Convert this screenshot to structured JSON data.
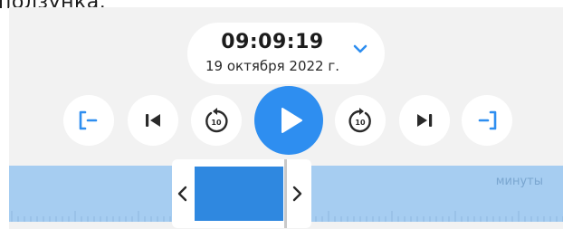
{
  "header_fragment": "ползунка.",
  "datetime": {
    "time": "09:09:19",
    "date": "19 октября 2022 г."
  },
  "controls": {
    "skip_icons": [
      "set-start-icon",
      "previous-icon",
      "rewind-10-icon",
      "play-icon",
      "forward-10-icon",
      "next-icon",
      "set-end-icon"
    ],
    "rewind_seconds": "10",
    "forward_seconds": "10"
  },
  "timeline": {
    "unit_label": "минуты"
  },
  "colors": {
    "accent": "#2e8ef0",
    "timeline": "#a6cdf1",
    "selection": "#2f88e0"
  }
}
